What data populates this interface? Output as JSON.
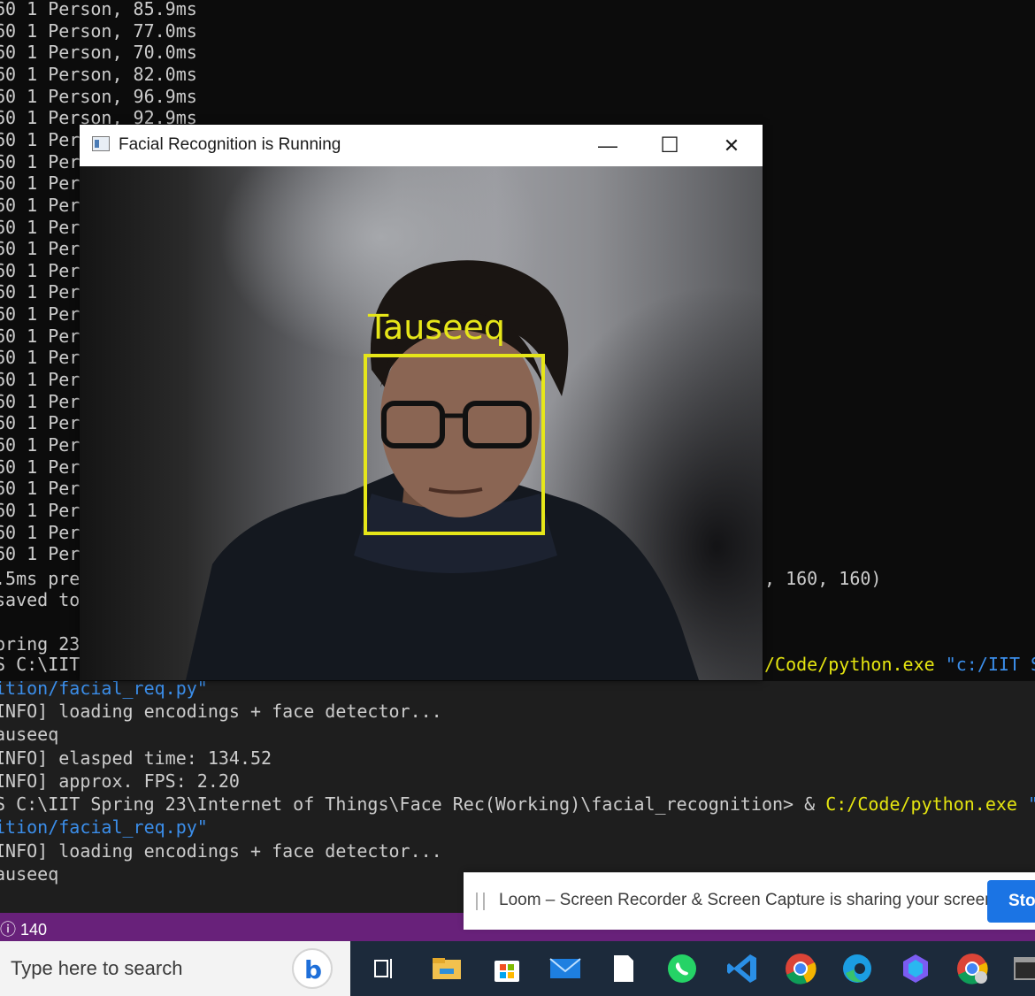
{
  "terminal": {
    "log_lines": [
      "60 1 Person, 85.9ms",
      "60 1 Person, 77.0ms",
      "60 1 Person, 70.0ms",
      "60 1 Person, 82.0ms",
      "60 1 Person, 96.9ms",
      "60 1 Person, 92.9ms",
      "60 1 Per",
      "60 1 Per",
      "60 1 Per",
      "60 1 Per",
      "60 1 Per",
      "60 1 Per",
      "60 1 Per",
      "60 1 Per",
      "60 1 Per",
      "60 1 Per",
      "60 1 Per",
      "60 1 Per",
      "60 1 Per",
      "60 1 Per",
      "60 1 Per",
      "60 1 Per",
      "60 1 Per",
      "60 1 Per",
      "60 1 Per",
      "60 1 Per"
    ],
    "speed_line": ".5ms pre",
    "saved_line": "saved to",
    "shape_tail": ", 160, 160)",
    "spring_line": "pring 23",
    "prompt_line": "S C:\\IIT",
    "cmd_tail_exe": "/Code/python.exe",
    "cmd_tail_str": "\"c:/IIT Spri"
  },
  "vscode_terminal": {
    "line1_path": "ition/facial_req.py\"",
    "line2": "INFO] loading encodings + face detector...",
    "line3": "auseeq",
    "line4": "INFO] elasped time: 134.52",
    "line5": "INFO] approx. FPS: 2.20",
    "line6_prompt": "S C:\\IIT Spring 23\\Internet of Things\\Face Rec(Working)\\facial_recognition> & ",
    "line6_exe": "C:/Code/python.exe",
    "line6_str": "\"c:/IIT Spri",
    "line7_path": "ition/facial_req.py\"",
    "line8": "INFO] loading encodings + face detector...",
    "line9": "auseeq"
  },
  "window": {
    "title": "Facial Recognition is Running",
    "min_glyph": "—",
    "max_glyph": "☐",
    "close_glyph": "✕",
    "face_label": "Tauseeq",
    "box_color": "#e6e619"
  },
  "status_bar": {
    "count": "140",
    "color": "#68217a"
  },
  "loom": {
    "message": "Loom – Screen Recorder & Screen Capture is sharing your screen.",
    "stop_label": "Stop"
  },
  "taskbar": {
    "search_placeholder": "Type here to search",
    "icons": [
      "task-view-icon",
      "file-explorer-icon",
      "microsoft-store-icon",
      "mail-icon",
      "notepad-icon",
      "whatsapp-icon",
      "vscode-icon",
      "chrome-icon",
      "edge-icon",
      "copilot-icon",
      "chrome-profile-icon",
      "terminal-icon"
    ]
  }
}
